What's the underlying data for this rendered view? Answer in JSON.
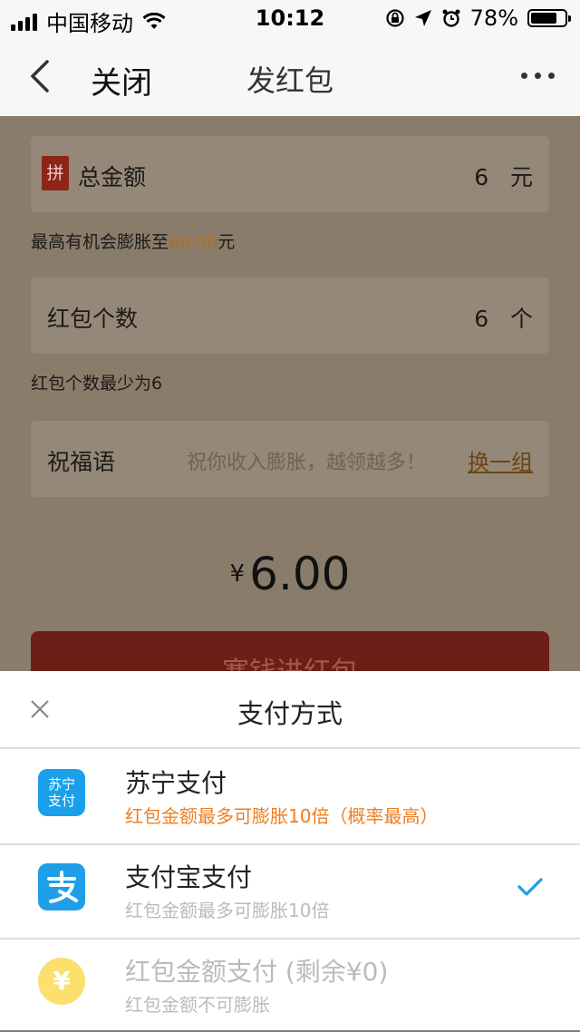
{
  "status": {
    "carrier": "中国移动",
    "time": "10:12",
    "battery_text": "78%",
    "battery_level": 0.78
  },
  "nav": {
    "close_label": "关闭",
    "title": "发红包"
  },
  "form": {
    "total": {
      "badge": "拼",
      "label": "总金额",
      "value": "6",
      "unit": "元"
    },
    "total_hint_prefix": "最高有机会膨胀至",
    "total_hint_amount": "60.00",
    "total_hint_suffix": "元",
    "count": {
      "label": "红包个数",
      "value": "6",
      "unit": "个"
    },
    "count_hint": "红包个数最少为6",
    "greeting": {
      "label": "祝福语",
      "placeholder": "祝你收入膨胀，越领越多！",
      "change_label": "换一组"
    },
    "amount_symbol": "¥",
    "amount_value": "6.00",
    "submit_label": "塞钱进红包"
  },
  "sheet": {
    "title": "支付方式",
    "options": [
      {
        "icon": "suning-pay-icon",
        "icon_text": "苏宁\n支付",
        "name": "苏宁支付",
        "sub": "红包金额最多可膨胀10倍（概率最高）",
        "selected": false
      },
      {
        "icon": "alipay-icon",
        "name": "支付宝支付",
        "sub": "红包金额最多可膨胀10倍",
        "selected": true
      },
      {
        "icon": "yen-coin-icon",
        "icon_text": "¥",
        "name": "红包金额支付 (剩余¥0)",
        "sub": "红包金额不可膨胀",
        "selected": false,
        "disabled": true
      }
    ]
  },
  "colors": {
    "accent_blue": "#1e9fe8",
    "orange": "#ef7e1d",
    "red_button": "#6d1f17"
  }
}
